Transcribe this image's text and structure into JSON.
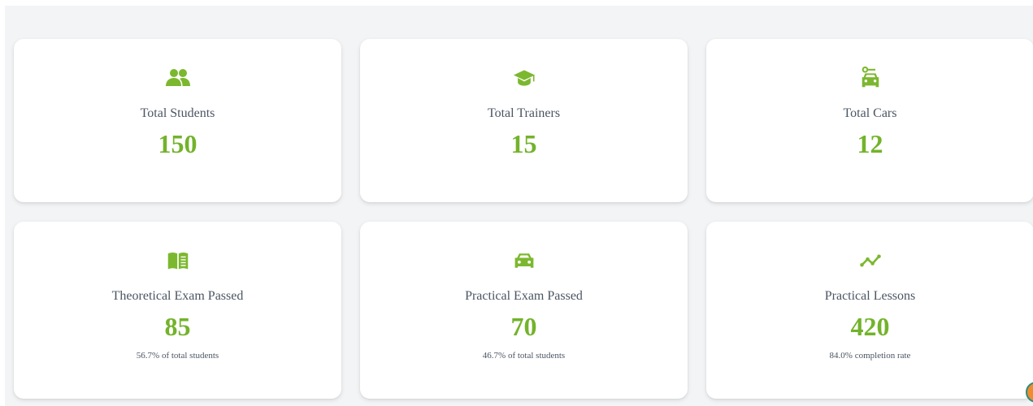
{
  "colors": {
    "accent": "#73b32b",
    "icon": "#7cb82f",
    "background": "#f3f4f6",
    "card": "#ffffff",
    "label": "#4b5563"
  },
  "stats": [
    {
      "icon": "users-icon",
      "label": "Total Students",
      "value": "150",
      "sub": ""
    },
    {
      "icon": "graduation-cap-icon",
      "label": "Total Trainers",
      "value": "15",
      "sub": ""
    },
    {
      "icon": "car-key-icon",
      "label": "Total Cars",
      "value": "12",
      "sub": ""
    },
    {
      "icon": "book-icon",
      "label": "Theoretical Exam Passed",
      "value": "85",
      "sub": "56.7% of total students"
    },
    {
      "icon": "car-icon",
      "label": "Practical Exam Passed",
      "value": "70",
      "sub": "46.7% of total students"
    },
    {
      "icon": "trend-line-icon",
      "label": "Practical Lessons",
      "value": "420",
      "sub": "84.0% completion rate"
    }
  ]
}
